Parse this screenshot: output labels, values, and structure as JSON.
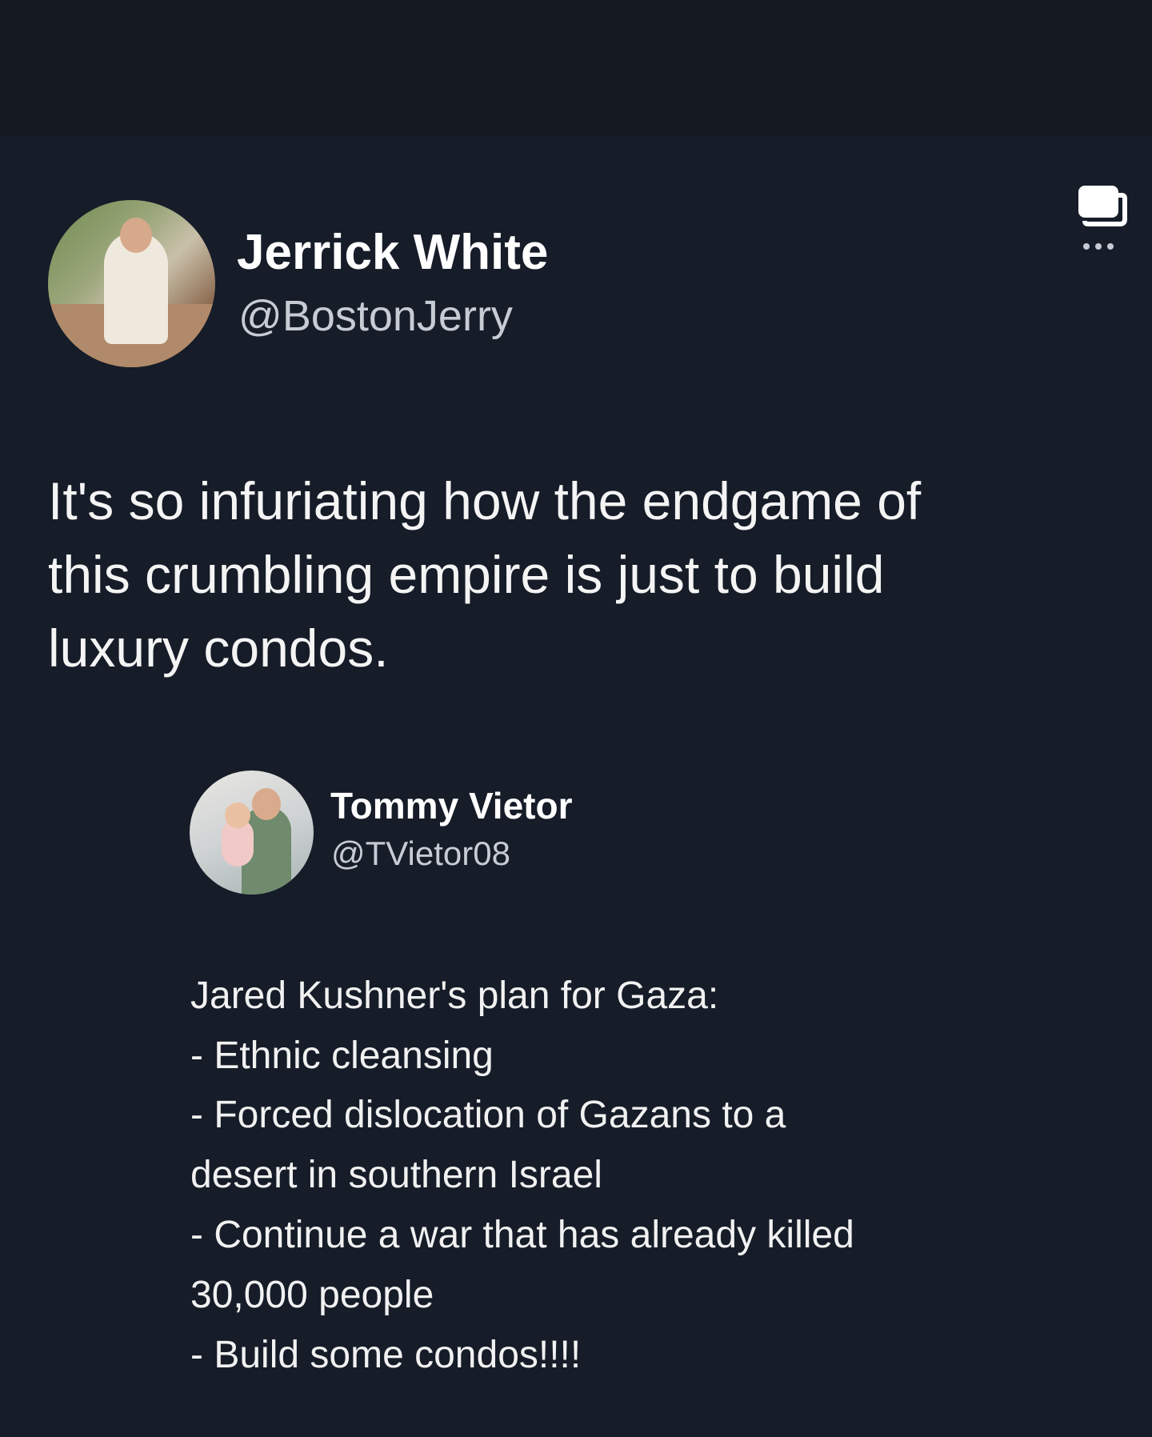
{
  "post": {
    "author": {
      "name": "Jerrick White",
      "handle": "@BostonJerry"
    },
    "text_lines": [
      "It's so infuriating how the endgame of",
      "this crumbling empire is just to build",
      "luxury condos."
    ]
  },
  "quoted_post": {
    "author": {
      "name": "Tommy Vietor",
      "handle": "@TVietor08"
    },
    "text_lines": [
      "Jared Kushner's plan for Gaza:",
      "- Ethnic cleansing",
      "- Forced dislocation of Gazans to a",
      "desert in southern Israel",
      "- Continue a war that has already killed",
      "30,000 people",
      "- Build some condos!!!!"
    ]
  },
  "icons": {
    "more": "more-options-icon"
  },
  "colors": {
    "background": "#161c28",
    "text": "#ffffff",
    "secondary_text": "#c7ccd4"
  }
}
